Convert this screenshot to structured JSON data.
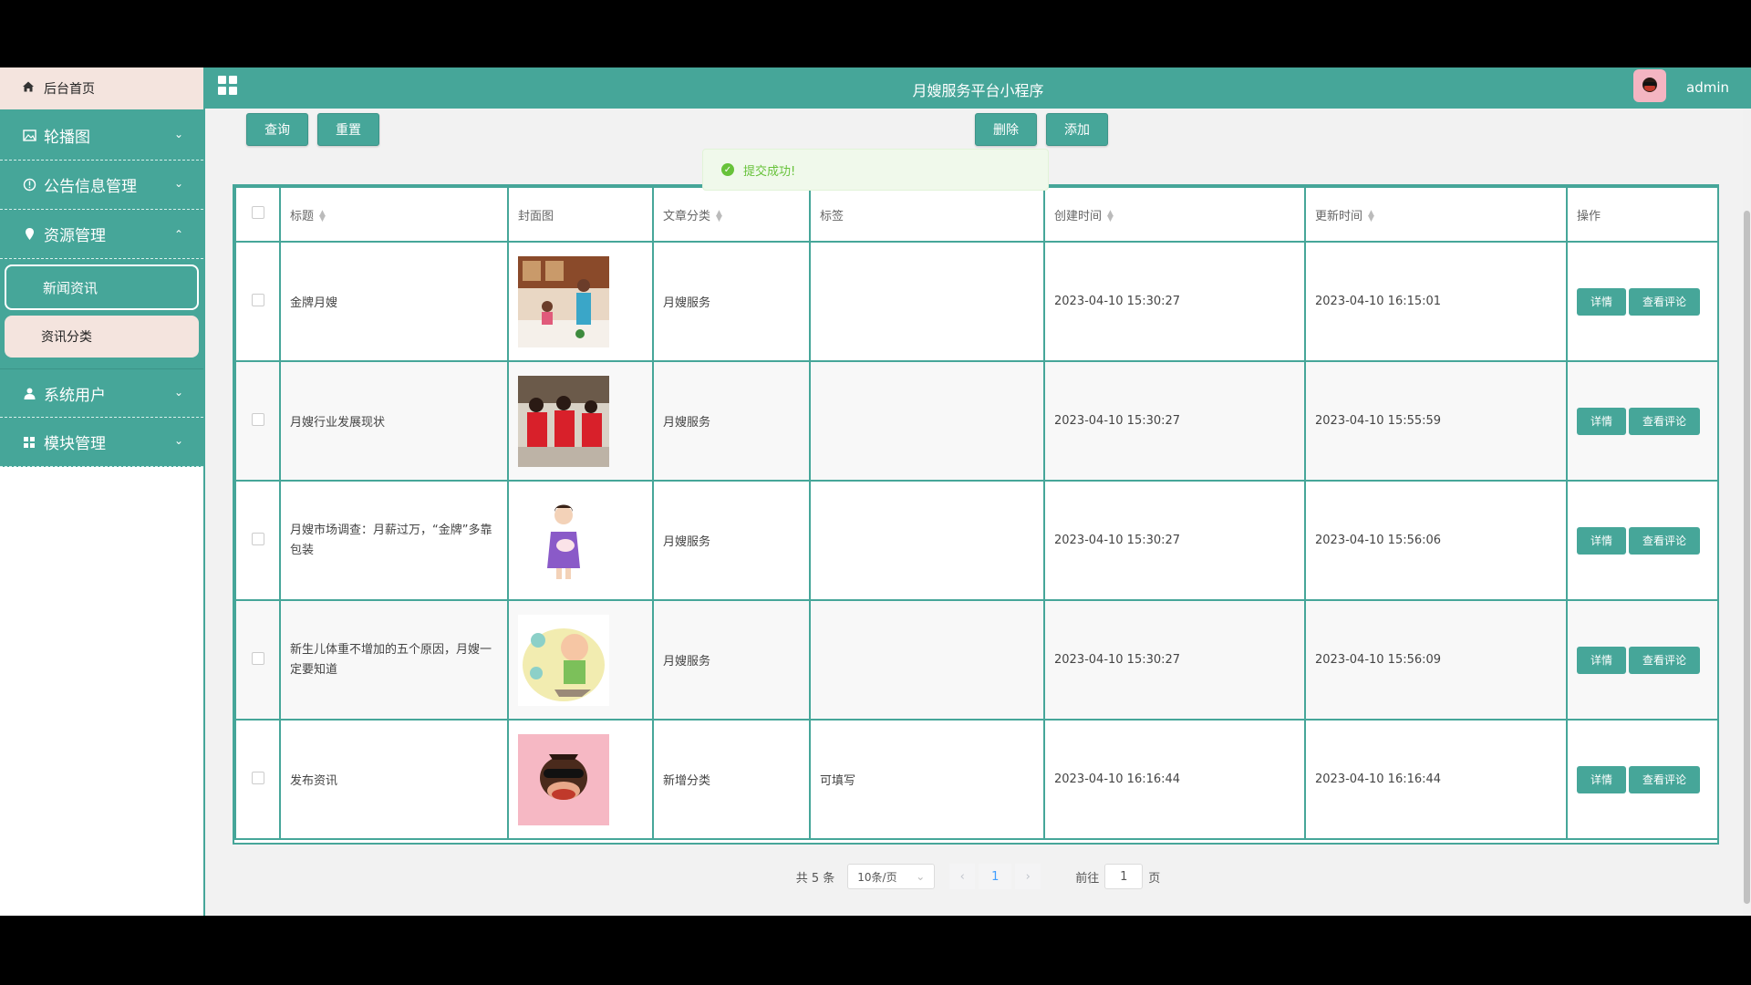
{
  "topbar": {
    "title": "月嫂服务平台小程序",
    "username": "admin"
  },
  "sidebar": {
    "home": "后台首页",
    "menus": [
      {
        "label": "轮播图",
        "icon": "image-icon",
        "expanded": false
      },
      {
        "label": "公告信息管理",
        "icon": "info-circle-icon",
        "expanded": false
      },
      {
        "label": "资源管理",
        "icon": "location-icon",
        "expanded": true
      },
      {
        "label": "系统用户",
        "icon": "user-icon",
        "expanded": false
      },
      {
        "label": "模块管理",
        "icon": "grid-icon",
        "expanded": false
      }
    ],
    "submenu": [
      {
        "label": "新闻资讯",
        "active": true
      },
      {
        "label": "资讯分类",
        "active": false
      }
    ]
  },
  "toolbar": {
    "query": "查询",
    "reset": "重置",
    "delete": "删除",
    "add": "添加"
  },
  "toast": "提交成功!",
  "table": {
    "headers": [
      "标题",
      "封面图",
      "文章分类",
      "标签",
      "创建时间",
      "更新时间",
      "操作"
    ],
    "rows": [
      {
        "title": "金牌月嫂",
        "category": "月嫂服务",
        "tag": "",
        "created": "2023-04-10 15:30:27",
        "updated": "2023-04-10 16:15:01"
      },
      {
        "title": "月嫂行业发展现状",
        "category": "月嫂服务",
        "tag": "",
        "created": "2023-04-10 15:30:27",
        "updated": "2023-04-10 15:55:59"
      },
      {
        "title": "月嫂市场调查：月薪过万，“金牌”多靠包装",
        "category": "月嫂服务",
        "tag": "",
        "created": "2023-04-10 15:30:27",
        "updated": "2023-04-10 15:56:06"
      },
      {
        "title": "新生儿体重不增加的五个原因，月嫂一定要知道",
        "category": "月嫂服务",
        "tag": "",
        "created": "2023-04-10 15:30:27",
        "updated": "2023-04-10 15:56:09"
      },
      {
        "title": "发布资讯",
        "category": "新增分类",
        "tag": "可填写",
        "created": "2023-04-10 16:16:44",
        "updated": "2023-04-10 16:16:44"
      }
    ],
    "detail_btn": "详情",
    "comment_btn": "查看评论"
  },
  "pager": {
    "total": "共 5 条",
    "page_size": "10条/页",
    "current": "1",
    "goto_prefix": "前往",
    "goto_value": "1",
    "goto_suffix": "页"
  },
  "colors": {
    "primary": "#46a699",
    "home_bg": "#f4e4de",
    "success": "#67c23a"
  }
}
